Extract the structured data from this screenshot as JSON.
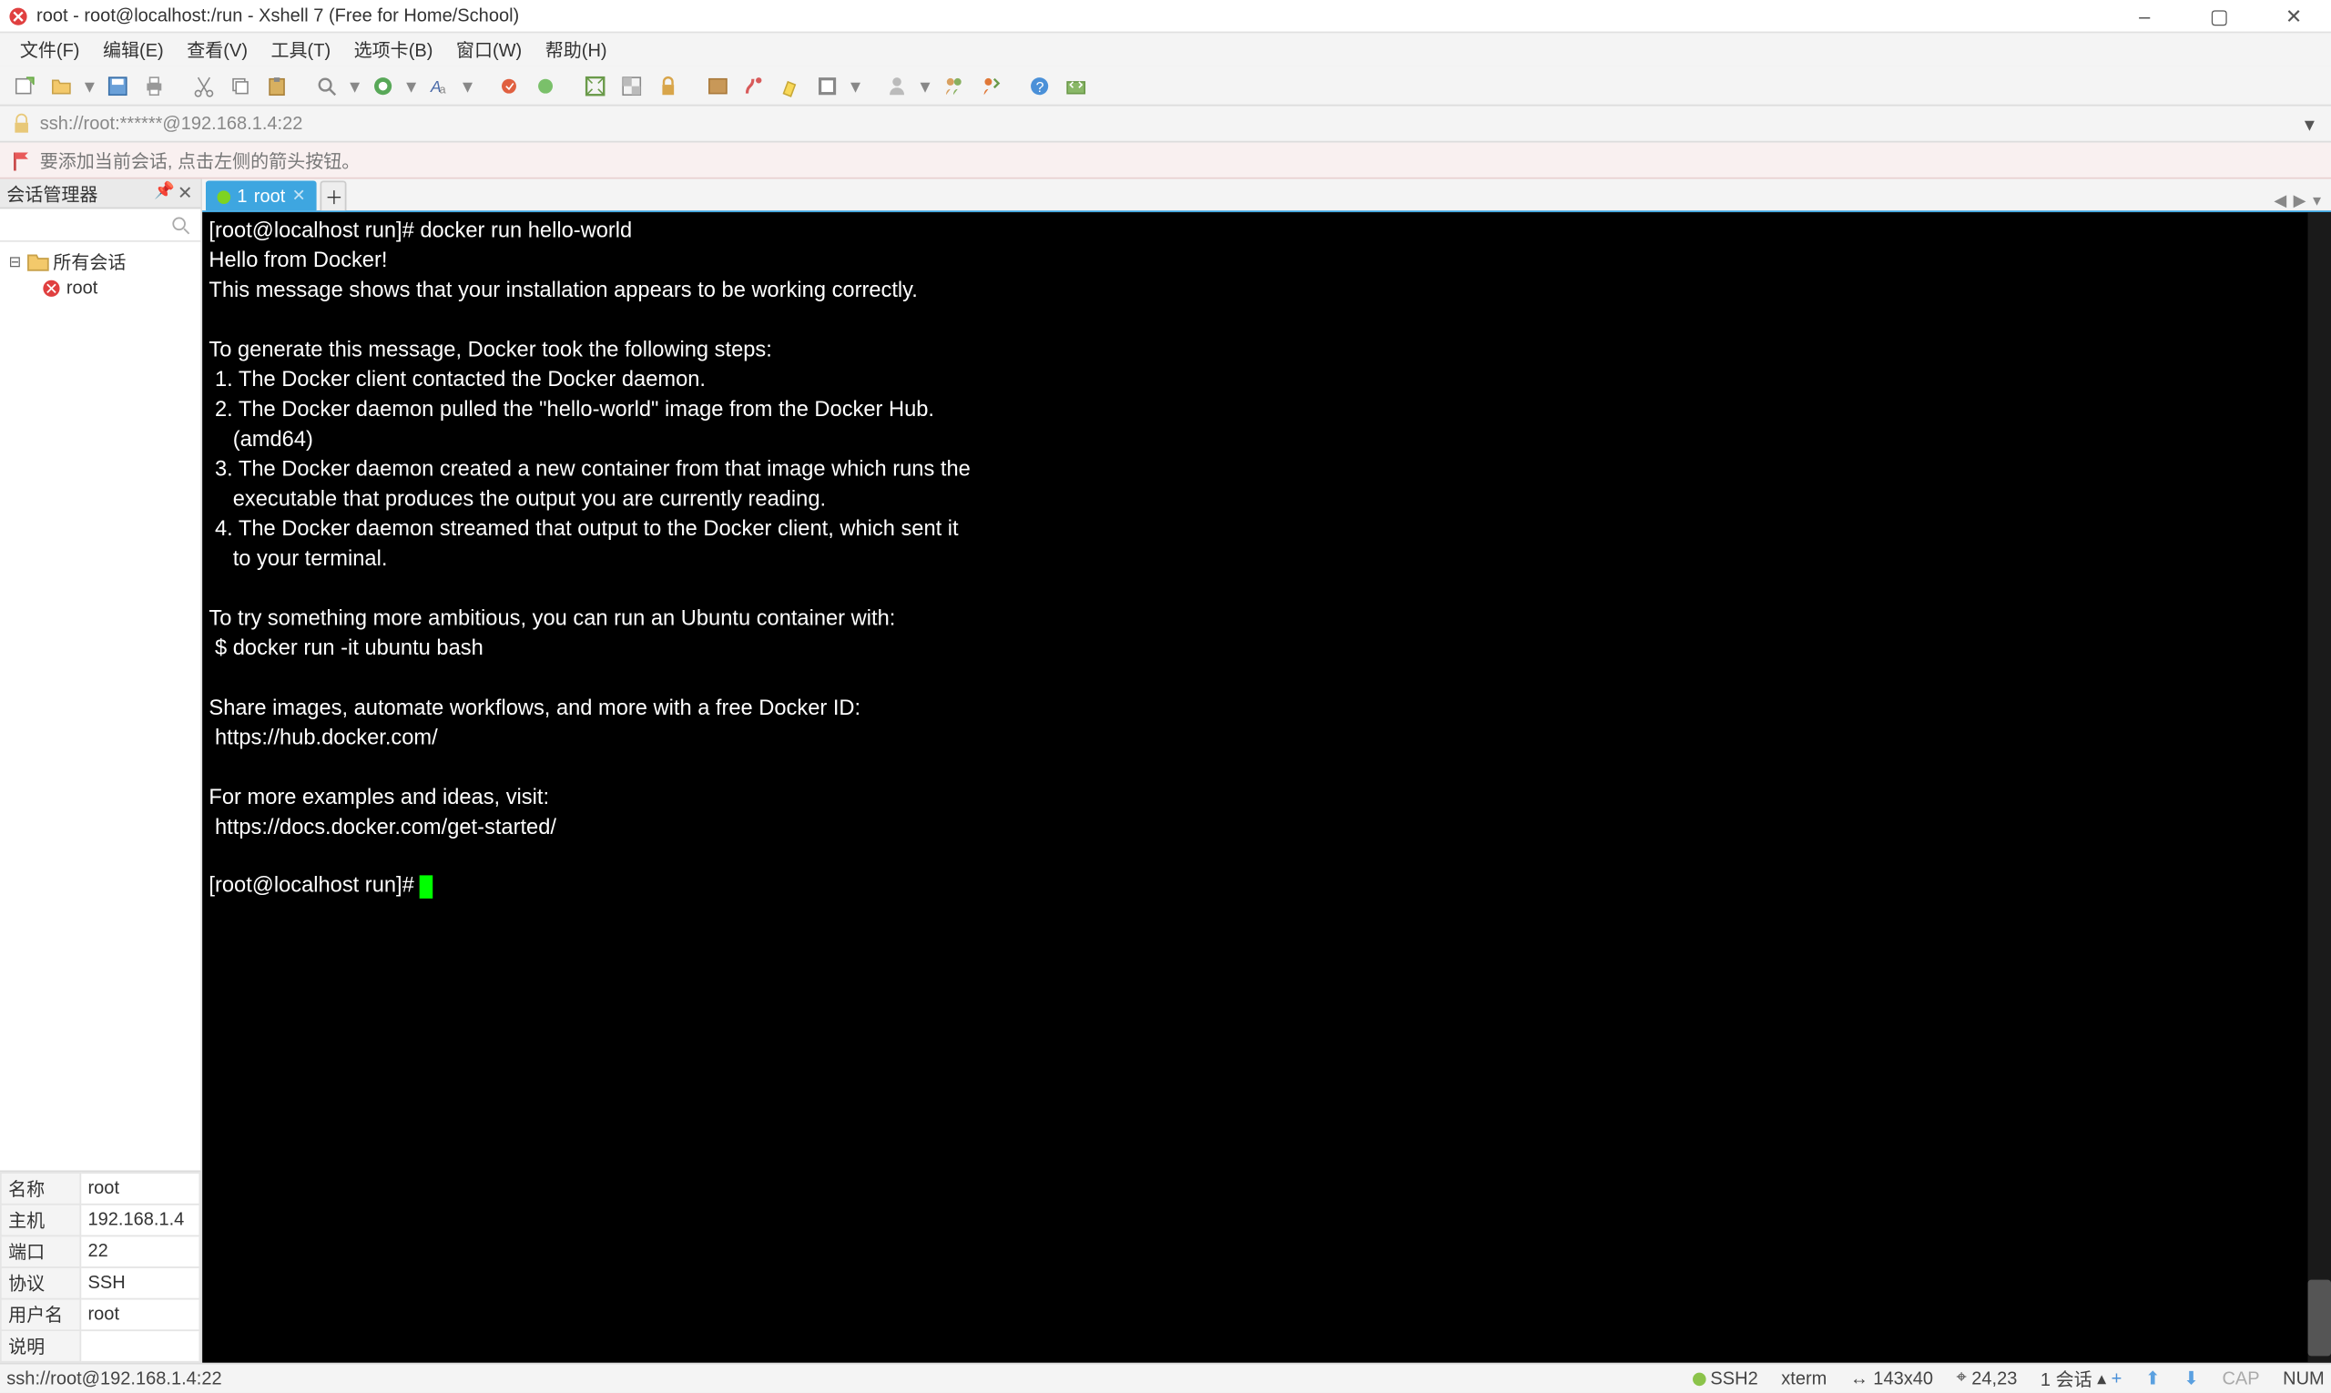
{
  "titlebar": {
    "title": "root - root@localhost:/run - Xshell 7 (Free for Home/School)"
  },
  "menubar": {
    "items": [
      "文件(F)",
      "编辑(E)",
      "查看(V)",
      "工具(T)",
      "选项卡(B)",
      "窗口(W)",
      "帮助(H)"
    ]
  },
  "addressbar": {
    "text": "ssh://root:******@192.168.1.4:22"
  },
  "hintbar": {
    "text": "要添加当前会话, 点击左侧的箭头按钮。"
  },
  "sidebar": {
    "title": "会话管理器",
    "root_label": "所有会话",
    "items": [
      {
        "label": "root"
      }
    ]
  },
  "properties": {
    "rows": [
      {
        "k": "名称",
        "v": "root"
      },
      {
        "k": "主机",
        "v": "192.168.1.4"
      },
      {
        "k": "端口",
        "v": "22"
      },
      {
        "k": "协议",
        "v": "SSH"
      },
      {
        "k": "用户名",
        "v": "root"
      },
      {
        "k": "说明",
        "v": ""
      }
    ]
  },
  "tabs": {
    "active": {
      "index": "1",
      "label": "root"
    }
  },
  "terminal": {
    "prompt1": "[root@localhost run]# docker run hello-world",
    "body": "\nHello from Docker!\nThis message shows that your installation appears to be working correctly.\n\nTo generate this message, Docker took the following steps:\n 1. The Docker client contacted the Docker daemon.\n 2. The Docker daemon pulled the \"hello-world\" image from the Docker Hub.\n    (amd64)\n 3. The Docker daemon created a new container from that image which runs the\n    executable that produces the output you are currently reading.\n 4. The Docker daemon streamed that output to the Docker client, which sent it\n    to your terminal.\n\nTo try something more ambitious, you can run an Ubuntu container with:\n $ docker run -it ubuntu bash\n\nShare images, automate workflows, and more with a free Docker ID:\n https://hub.docker.com/\n\nFor more examples and ideas, visit:\n https://docs.docker.com/get-started/\n",
    "prompt2": "[root@localhost run]# "
  },
  "statusbar": {
    "left": "ssh://root@192.168.1.4:22",
    "proto": "SSH2",
    "term": "xterm",
    "size": "143x40",
    "pos": "24,23",
    "sessions_label": "1 会话",
    "cap": "CAP",
    "num": "NUM"
  }
}
